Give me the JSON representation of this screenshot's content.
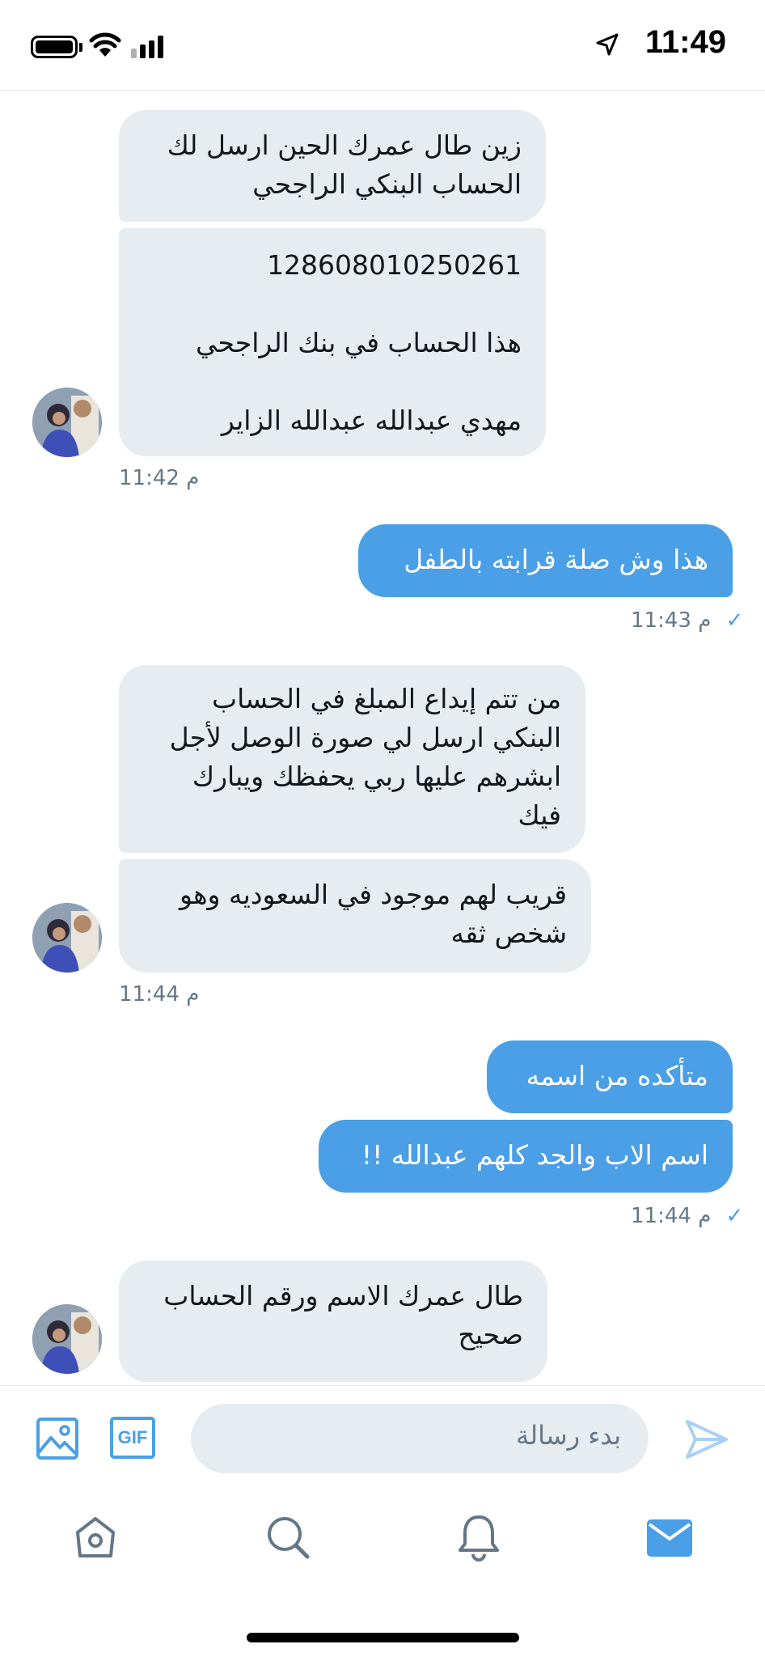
{
  "status_bar": {
    "time": "11:49"
  },
  "messages": [
    {
      "id": "in1a",
      "direction": "incoming",
      "lines": [
        "زين طال عمرك الحين ارسل لك",
        "الحساب البنكي الراجحي"
      ]
    },
    {
      "id": "in1b",
      "direction": "incoming",
      "lines": [
        "128608010250261",
        "",
        "هذا الحساب في  بنك الراجحي",
        "",
        "مهدي عبدالله عبدالله الزاير"
      ]
    },
    {
      "id": "ts1",
      "time": "11:42",
      "suffix": "م"
    },
    {
      "id": "out1",
      "direction": "outgoing",
      "lines": [
        "هذا وش صلة قرابته بالطفل"
      ]
    },
    {
      "id": "ts2",
      "time": "11:43",
      "suffix": "م"
    },
    {
      "id": "in2a",
      "direction": "incoming",
      "lines": [
        "من تتم إيداع المبلغ في الحساب",
        "البنكي ارسل لي صورة الوصل لأجل",
        "ابشرهم عليها ربي يحفظك ويبارك",
        "فيك"
      ]
    },
    {
      "id": "in2b",
      "direction": "incoming",
      "lines": [
        "قريب لهم موجود في السعوديه وهو",
        "شخص ثقه"
      ]
    },
    {
      "id": "ts3",
      "time": "11:44",
      "suffix": "م"
    },
    {
      "id": "out2a",
      "direction": "outgoing",
      "lines": [
        "متأكده من اسمه"
      ]
    },
    {
      "id": "out2b",
      "direction": "outgoing",
      "lines": [
        "اسم الاب والجد كلهم عبدالله !!"
      ]
    },
    {
      "id": "ts4",
      "time": "11:44",
      "suffix": "م"
    },
    {
      "id": "in3a",
      "direction": "incoming",
      "lines": [
        "طال عمرك الاسم ورقم الحساب",
        "صحيح"
      ]
    }
  ],
  "composer": {
    "placeholder": "بدء رسالة",
    "gif_label": "GIF"
  },
  "tabbar": {
    "active": "messages",
    "items": [
      "home",
      "search",
      "notifications",
      "messages"
    ]
  },
  "colors": {
    "accent": "#4a9fe6",
    "incoming_bubble": "#e6ecf0",
    "timestamp": "#657786"
  }
}
